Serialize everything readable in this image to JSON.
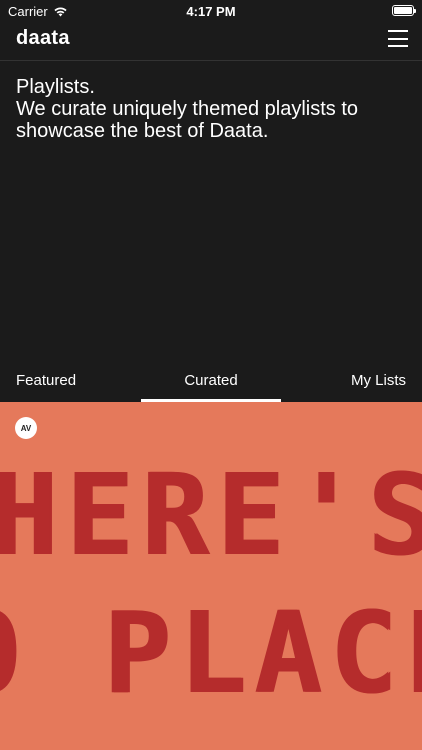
{
  "status_bar": {
    "carrier": "Carrier",
    "time": "4:17 PM"
  },
  "header": {
    "logo": "daata"
  },
  "intro": {
    "line1": "Playlists.",
    "line2": "We curate uniquely themed playlists to showcase the best of Daata."
  },
  "tabs": [
    {
      "label": "Featured"
    },
    {
      "label": "Curated",
      "active": true
    },
    {
      "label": "My Lists"
    }
  ],
  "card": {
    "badge": "AV",
    "artwork_line1": "HERE'S",
    "artwork_line2": "O PLACE",
    "background_color": "#e5795b",
    "stitch_color": "#b52c2c"
  }
}
